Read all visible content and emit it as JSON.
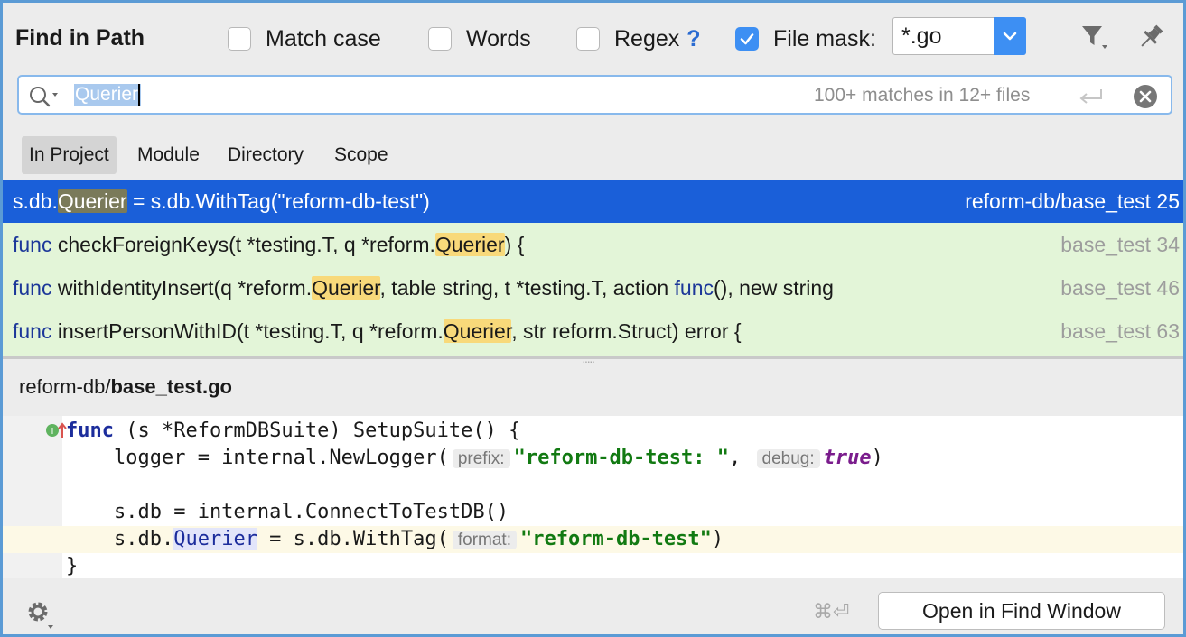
{
  "header": {
    "title": "Find in Path",
    "match_case": {
      "label": "Match case",
      "checked": false
    },
    "words": {
      "label": "Words",
      "checked": false
    },
    "regex": {
      "label": "Regex",
      "checked": false,
      "help": "?"
    },
    "file_mask": {
      "label": "File mask:",
      "checked": true,
      "value": "*.go"
    },
    "icons": [
      "filter-icon",
      "pin-icon"
    ]
  },
  "search": {
    "query": "Querier",
    "match_count": "100+ matches in 12+ files",
    "icons": [
      "search-icon",
      "enter-icon",
      "clear-icon"
    ]
  },
  "scope_tabs": [
    {
      "label": "In Project",
      "active": true
    },
    {
      "label": "Module",
      "active": false
    },
    {
      "label": "Directory",
      "active": false
    },
    {
      "label": "Scope",
      "active": false
    }
  ],
  "results": [
    {
      "pre_kw": "",
      "pre": "s.db.",
      "match": "Querier",
      "post": " = s.db.WithTag(\"reform-db-test\")",
      "file": "reform-db/base_test",
      "line": "25",
      "selected": true
    },
    {
      "pre_kw": "func",
      "pre": " checkForeignKeys(t *testing.T, q *reform.",
      "match": "Querier",
      "post": ") {",
      "file": "base_test",
      "line": "34",
      "selected": false
    },
    {
      "pre_kw": "func",
      "pre": " withIdentityInsert(q *reform.",
      "match": "Querier",
      "post": ", table string, t *testing.T, action ",
      "post_kw": "func",
      "post2": "(), new string",
      "file": "base_test",
      "line": "46",
      "selected": false
    },
    {
      "pre_kw": "func",
      "pre": " insertPersonWithID(t *testing.T, q *reform.",
      "match": "Querier",
      "post": ", str reform.Struct) error {",
      "file": "base_test",
      "line": "63",
      "selected": false
    }
  ],
  "preview": {
    "path_prefix": "reform-db/",
    "path_file": "base_test.go",
    "lines": {
      "l1_kw": "func",
      "l1_rest": " (s *ReformDBSuite) SetupSuite() {",
      "l2_a": "    logger = internal.NewLogger(",
      "l2_hint1": "prefix:",
      "l2_str": "\"reform-db-test: \"",
      "l2_comma": ",",
      "l2_hint2": "debug:",
      "l2_bool": "true",
      "l2_end": ")",
      "l4": "    s.db = internal.ConnectToTestDB()",
      "l5_a": "    s.db.",
      "l5_match": "Querier",
      "l5_b": " = s.db.WithTag(",
      "l5_hint": "format:",
      "l5_str": "\"reform-db-test\"",
      "l5_end": ")",
      "l6": "}"
    }
  },
  "footer": {
    "shortcut": "⌘⏎",
    "open_button": "Open in Find Window",
    "icons": [
      "settings-gear-icon"
    ]
  },
  "colors": {
    "selection": "#1a5fd9",
    "match_highlight": "#f8d97a",
    "results_bg": "#e3f5d8",
    "accent": "#3d8ff3"
  }
}
